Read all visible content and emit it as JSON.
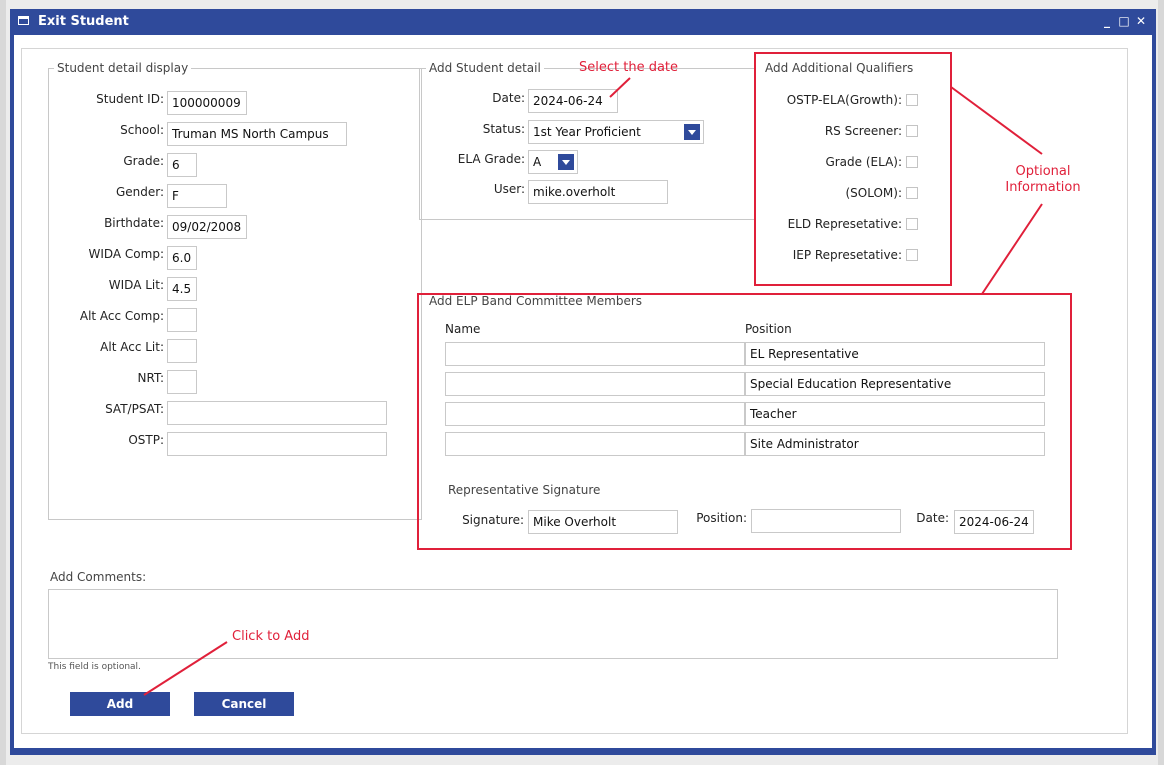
{
  "window": {
    "title": "Exit Student",
    "minimize_glyph": "_",
    "maximize_glyph": "□",
    "close_glyph": "✕"
  },
  "student_display": {
    "legend": "Student detail display",
    "fields": [
      {
        "label": "Student ID:",
        "value": "100000009"
      },
      {
        "label": "School:",
        "value": "Truman MS North Campus"
      },
      {
        "label": "Grade:",
        "value": "6"
      },
      {
        "label": "Gender:",
        "value": "F"
      },
      {
        "label": "Birthdate:",
        "value": "09/02/2008"
      },
      {
        "label": "WIDA Comp:",
        "value": "6.0"
      },
      {
        "label": "WIDA Lit:",
        "value": "4.5"
      },
      {
        "label": "Alt Acc Comp:",
        "value": ""
      },
      {
        "label": "Alt Acc Lit:",
        "value": ""
      },
      {
        "label": "NRT:",
        "value": ""
      },
      {
        "label": "SAT/PSAT:",
        "value": ""
      },
      {
        "label": "OSTP:",
        "value": ""
      }
    ]
  },
  "add_detail": {
    "legend": "Add Student detail",
    "date_label": "Date:",
    "date_value": "2024-06-24",
    "status_label": "Status:",
    "status_value": "1st Year Proficient",
    "ela_label": "ELA Grade:",
    "ela_value": "A",
    "user_label": "User:",
    "user_value": "mike.overholt"
  },
  "qualifiers": {
    "legend": "Add Additional Qualifiers",
    "items": [
      "OSTP-ELA(Growth):",
      "RS Screener:",
      "Grade (ELA):",
      "(SOLOM):",
      "ELD Represetative:",
      "IEP Represetative:"
    ]
  },
  "committee": {
    "legend": "Add ELP Band Committee Members",
    "name_header": "Name",
    "position_header": "Position",
    "rows": [
      {
        "name": "",
        "position": "EL Representative"
      },
      {
        "name": "",
        "position": "Special Education Representative"
      },
      {
        "name": "",
        "position": "Teacher"
      },
      {
        "name": "",
        "position": "Site Administrator"
      }
    ],
    "sig_heading": "Representative Signature",
    "signature_label": "Signature:",
    "signature_value": "Mike Overholt",
    "position_label": "Position:",
    "position_value": "",
    "date_label": "Date:",
    "date_value": "2024-06-24"
  },
  "comments": {
    "label": "Add Comments:",
    "hint": "This field is optional."
  },
  "buttons": {
    "add": "Add",
    "cancel": "Cancel"
  },
  "annotations": {
    "select_date": "Select the date",
    "optional": "Optional Information",
    "click_add": "Click to Add",
    "color": "#e0203a"
  }
}
